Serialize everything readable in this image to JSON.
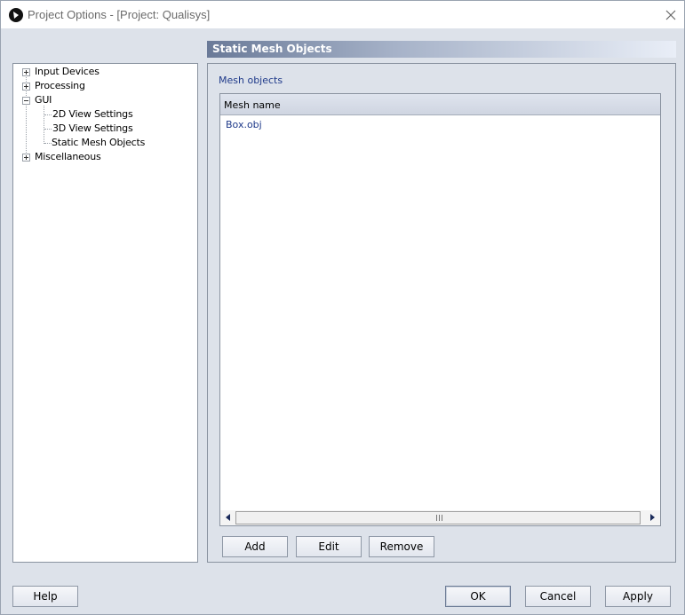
{
  "window": {
    "title": "Project Options - [Project: Qualisys]",
    "icons": {
      "app": "qualisys-logo-icon",
      "close": "close-icon"
    }
  },
  "tree": {
    "items": [
      {
        "label": "Input Devices",
        "level": 0,
        "expander": "plus"
      },
      {
        "label": "Processing",
        "level": 0,
        "expander": "plus"
      },
      {
        "label": "GUI",
        "level": 0,
        "expander": "minus"
      },
      {
        "label": "2D View Settings",
        "level": 1
      },
      {
        "label": "3D View Settings",
        "level": 1
      },
      {
        "label": "Static Mesh Objects",
        "level": 1,
        "selected": true
      },
      {
        "label": "Miscellaneous",
        "level": 0,
        "expander": "plus"
      }
    ]
  },
  "page": {
    "header": "Static Mesh Objects",
    "group_label": "Mesh objects",
    "list": {
      "column": "Mesh name",
      "rows": [
        "Box.obj"
      ]
    },
    "buttons": {
      "add": "Add",
      "edit": "Edit",
      "remove": "Remove"
    }
  },
  "footer": {
    "help": "Help",
    "ok": "OK",
    "cancel": "Cancel",
    "apply": "Apply"
  },
  "colors": {
    "window_bg": "#dde2ea",
    "accent_text": "#1f3a8a",
    "banner_start": "#6a7a98"
  }
}
